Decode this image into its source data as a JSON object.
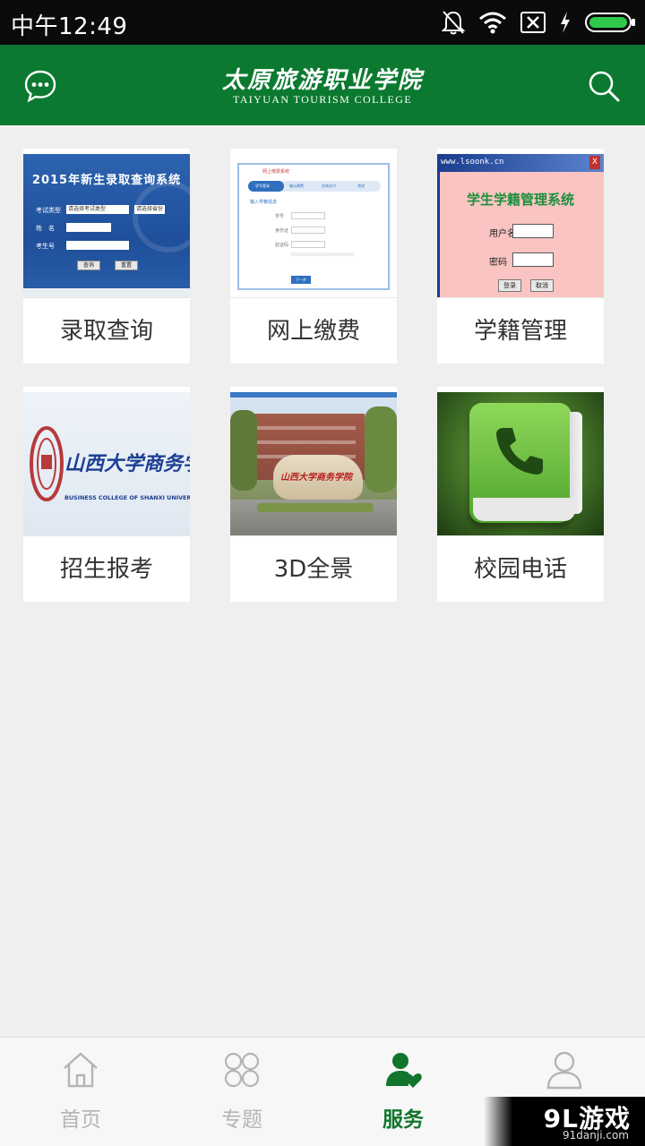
{
  "status_bar": {
    "time": "中午12:49",
    "icons": [
      "mute-bell-icon",
      "wifi-icon",
      "no-sim-icon",
      "charging-icon",
      "battery-icon"
    ]
  },
  "header": {
    "title_cn": "太原旅游职业学院",
    "title_en": "TAIYUAN TOURISM COLLEGE",
    "left_icon": "message-icon",
    "right_icon": "search-icon",
    "bg_color": "#0b7a30"
  },
  "tiles": [
    {
      "label": "录取查询",
      "thumb": {
        "title": "2015年新生录取查询系统",
        "fields": [
          "考试类型",
          "姓　名",
          "考生号"
        ],
        "select_1": "请选择考试类型",
        "select_2": "请选择省份",
        "btn_1": "查询",
        "btn_2": "重置"
      }
    },
    {
      "label": "网上缴费",
      "thumb": {
        "header": "网上缴费系统",
        "step_1": "学号登录",
        "step_2": "确认缴费",
        "step_3": "在线支付",
        "step_4": "完成",
        "section": "输入学籍信息",
        "f1_label": "学号",
        "f2_label": "身份证",
        "f3_label": "验证码",
        "button": "下一步"
      }
    },
    {
      "label": "学籍管理",
      "thumb": {
        "titlebar": "www.lsoonk.cn",
        "close": "X",
        "title": "学生学籍管理系统",
        "user_label": "用户名",
        "pwd_label": "密码",
        "btn_1": "登录",
        "btn_2": "取消"
      }
    },
    {
      "label": "招生报考",
      "thumb": {
        "cn": "山西大学商务学院",
        "en": "BUSINESS COLLEGE OF SHANXI UNIVERSITY"
      }
    },
    {
      "label": "3D全景",
      "thumb": {
        "rock_text": "山西大学商务学院"
      }
    },
    {
      "label": "校园电话"
    }
  ],
  "tabbar": {
    "tabs": [
      {
        "label": "首页",
        "icon": "home-icon",
        "active": false
      },
      {
        "label": "专题",
        "icon": "clover-icon",
        "active": false
      },
      {
        "label": "服务",
        "icon": "user-heart-icon",
        "active": true
      },
      {
        "label": "我的",
        "icon": "user-icon",
        "active": false
      }
    ],
    "active_color": "#12752d",
    "inactive_color": "#b4b4b4"
  },
  "watermark": {
    "main": "9L游戏",
    "sub": "91danji.com"
  }
}
